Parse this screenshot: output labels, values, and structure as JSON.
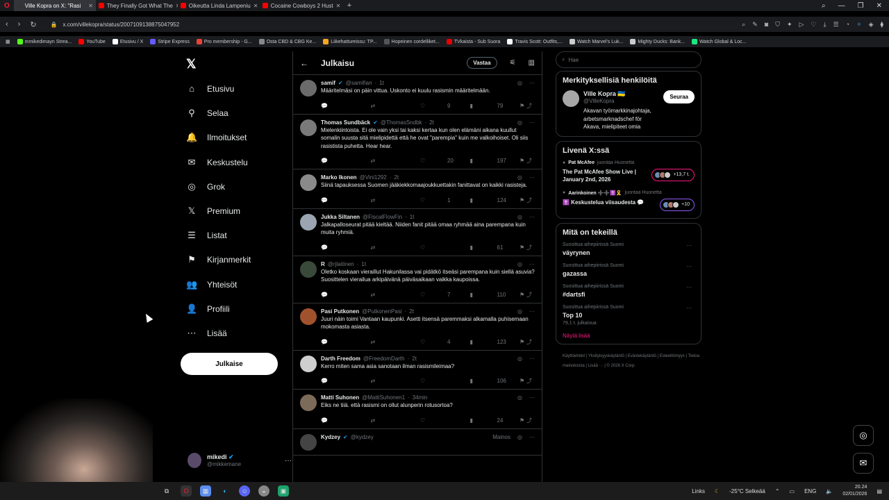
{
  "browser": {
    "tabs": [
      {
        "title": "Ville Kopra on X: \"Rasi",
        "color": "#333",
        "active": true
      },
      {
        "title": "They Finally Got What The",
        "color": "#ff0000",
        "active": false
      },
      {
        "title": "Oikeutta Linda Lampeniu",
        "color": "#ff0000",
        "active": false
      },
      {
        "title": "Cocaine Cowboys 2 Hust",
        "color": "#ff0000",
        "active": false
      }
    ],
    "url": "x.com/villekopra/status/2007109138875047952",
    "bookmarks": [
      {
        "label": "mmikedimayn Strea...",
        "color": "#53fc18"
      },
      {
        "label": "YouTube",
        "color": "#ff0000"
      },
      {
        "label": "Etusivu / X",
        "color": "#ffffff"
      },
      {
        "label": "Stripe Express",
        "color": "#635bff"
      },
      {
        "label": "Pro membership - G...",
        "color": "#ea4335"
      },
      {
        "label": "Osta CBD & CBG Ke...",
        "color": "#888888"
      },
      {
        "label": "Liikehattureissu: TP...",
        "color": "#f5a623"
      },
      {
        "label": "Hopeinen cordelliket...",
        "color": "#555555"
      },
      {
        "label": "TVkaista - Sub Suora",
        "color": "#e60000"
      },
      {
        "label": "Travis Scott: Outfits,...",
        "color": "#ffffff"
      },
      {
        "label": "Watch Marvel's Luk...",
        "color": "#cccccc"
      },
      {
        "label": "Mighty Ducks: Bank...",
        "color": "#cccccc"
      },
      {
        "label": "Watch Global & Loc...",
        "color": "#1ce783"
      }
    ]
  },
  "sidebar": {
    "items": [
      {
        "label": "Etusivu",
        "icon": "⌂"
      },
      {
        "label": "Selaa",
        "icon": "⚲"
      },
      {
        "label": "Ilmoitukset",
        "icon": "🔔"
      },
      {
        "label": "Keskustelu",
        "icon": "✉"
      },
      {
        "label": "Grok",
        "icon": "◎"
      },
      {
        "label": "Premium",
        "icon": "𝕏"
      },
      {
        "label": "Listat",
        "icon": "☰"
      },
      {
        "label": "Kirjanmerkit",
        "icon": "⚑"
      },
      {
        "label": "Yhteisöt",
        "icon": "👥"
      },
      {
        "label": "Profiili",
        "icon": "👤"
      },
      {
        "label": "Lisää",
        "icon": "⋯"
      }
    ],
    "post_label": "Julkaise",
    "account": {
      "name": "mikedi",
      "handle": "@mikkemane"
    }
  },
  "main": {
    "title": "Julkaisu",
    "reply_label": "Vastaa",
    "tweets": [
      {
        "name": "samif",
        "verified": true,
        "handle": "@samifian",
        "time": "1t",
        "text": "Määritelmäsi on päin vittua. Uskonto ei kuulu rasismin määritelmään.",
        "replies": "",
        "retweets": "",
        "likes": "9",
        "views": "79",
        "avatar": "#6b6b6b"
      },
      {
        "name": "Thomas Sundbäck",
        "verified": true,
        "handle": "@ThomasSndbk",
        "time": "2t",
        "text": "Mielenkiintoista. Ei ole vain yksi tai kaksi kertaa kun olen elämäni aikana kuullut somalin suusta sitä mielipidettä että he ovat \"parempia\" kuin me valkoihoiset. Oli siis rasistista puhetta. Hear hear.",
        "replies": "",
        "retweets": "",
        "likes": "20",
        "views": "197",
        "avatar": "#7a7a7a"
      },
      {
        "name": "Marko Ikonen",
        "verified": false,
        "handle": "@Vini1292",
        "time": "2t",
        "text": "Siinä tapauksessa Suomen jääkiekkomaajoukkuettakin fanittavat on kaikki rasisteja.",
        "replies": "",
        "retweets": "",
        "likes": "1",
        "views": "124",
        "avatar": "#8a8a8a"
      },
      {
        "name": "Jukka Siltanen",
        "verified": false,
        "handle": "@FiscalFlowFin",
        "time": "1t",
        "text": "Jalkapalloseurat pitää kieltää. Niiden fanit pitää omaa ryhmää aina parempana kuin muita ryhmiä.",
        "replies": "",
        "retweets": "",
        "likes": "",
        "views": "61",
        "avatar": "#9aa5b1"
      },
      {
        "name": "R",
        "verified": false,
        "handle": "@rjlaitinen",
        "time": "1t",
        "text": "Oletko koskaan vieraillut Hakunilassa vai pidätkö itseäsi parempana kuin siellä asuvia?\nSuosittelen vierailua arkipäivänä päiväsaikaan vaikka kaupoissa.",
        "replies": "",
        "retweets": "",
        "likes": "7",
        "views": "110",
        "avatar": "#3a4a3a"
      },
      {
        "name": "Pasi Putkonen",
        "verified": false,
        "handle": "@PutkonenPasi",
        "time": "2t",
        "text": "Juuri näin toimi Vantaan kaupunki. Asetti itsensä paremmaksi alkamalla puhisemaan mokomasta asiasta.",
        "replies": "",
        "retweets": "",
        "likes": "4",
        "views": "123",
        "avatar": "#a0522d"
      },
      {
        "name": "Darth Freedom",
        "verified": false,
        "handle": "@FreedomDarth",
        "time": "2t",
        "text": "Kerro miten sama asia sanotaan ilman rasismileimaa?",
        "replies": "",
        "retweets": "",
        "likes": "",
        "views": "106",
        "avatar": "#cfcfcf"
      },
      {
        "name": "Matti Suhonen",
        "verified": false,
        "handle": "@MattiSuhonen1",
        "time": "34min",
        "text": "Eiks ne tiiä. että rasismi on ollut alunperin rotusortoa?",
        "replies": "",
        "retweets": "",
        "likes": "",
        "views": "24",
        "avatar": "#7d6b5a"
      },
      {
        "name": "Kydzey",
        "verified": true,
        "handle": "@kydzey",
        "time": "",
        "text": "",
        "replies": "",
        "retweets": "",
        "likes": "",
        "views": "",
        "avatar": "#444444",
        "ad": "Mainos"
      }
    ]
  },
  "right": {
    "search_placeholder": "Hae",
    "who_title": "Merkityksellisiä henkilöitä",
    "who": {
      "name": "Ville Kopra 🇺🇦",
      "handle": "@VilleKopra",
      "bio": "Akavan työmarkkinajohtaja, arbetsmarknadschef för Akava, mielipiteet omia",
      "follow_label": "Seuraa"
    },
    "live_title": "Livenä X:ssä",
    "live": [
      {
        "host": "Pat McAfee",
        "note": "juontaa Huonetta",
        "title": "The Pat McAfee Show Live | January 2nd, 2026",
        "count": "+13,7 t."
      },
      {
        "host": "Aarinkoinen ➕➕✝️🎗️",
        "note": "juontaa Huonetta",
        "title": "✝️ Keskustelua viisaudesta 💬",
        "count": "+10"
      }
    ],
    "trends_title": "Mitä on tekeillä",
    "trends": [
      {
        "context": "Suosittua aihepiirissä Suomi",
        "topic": "väyrynen",
        "count": ""
      },
      {
        "context": "Suosittua aihepiirissä Suomi",
        "topic": "gazassa",
        "count": ""
      },
      {
        "context": "Suosittua aihepiirissä Suomi",
        "topic": "#dartsfi",
        "count": ""
      },
      {
        "context": "Suosittua aihepiirissä Suomi",
        "topic": "Top 10",
        "count": "79,1 t. julkaisua"
      }
    ],
    "show_more": "Näytä lisää",
    "footer": [
      "Käyttöehdot",
      "Yksityisyyskäytäntö",
      "Evästekäytäntö",
      "Esteettömyys",
      "Tietoa mainoksista",
      "Lisää ···",
      "© 2026 X Corp."
    ]
  },
  "taskbar": {
    "links": "Links",
    "weather": "-25°C Selkeää",
    "lang": "ENG",
    "time": "20.24",
    "date": "02/01/2026"
  }
}
